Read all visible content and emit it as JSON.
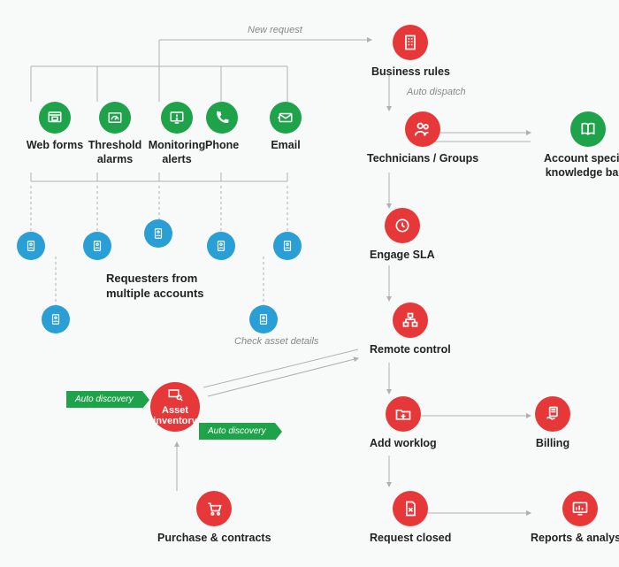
{
  "top_note": "New request",
  "inputs": {
    "web_forms": "Web forms",
    "threshold": "Threshold alarms",
    "monitoring": "Monitoring alerts",
    "phone": "Phone",
    "email": "Email"
  },
  "requesters_label": "Requesters from\nmultiple accounts",
  "flow": {
    "business_rules": "Business rules",
    "auto_dispatch_note": "Auto dispatch",
    "technicians": "Technicians / Groups",
    "knowledge_base": "Account specific knowledge base",
    "engage_sla": "Engage SLA",
    "remote_control": "Remote control",
    "check_asset_note": "Check asset details",
    "asset_inventory": "Asset inventory",
    "auto_discovery": "Auto discovery",
    "add_worklog": "Add worklog",
    "billing": "Billing",
    "request_closed": "Request closed",
    "reports": "Reports & analysis",
    "purchase": "Purchase & contracts"
  },
  "icons": {
    "web_forms": "browser-file-icon",
    "threshold": "gauge-icon",
    "monitoring": "alert-monitor-icon",
    "phone": "phone-icon",
    "email": "envelope-icon",
    "requester": "person-doc-icon",
    "business_rules": "building-icon",
    "technicians": "group-icon",
    "knowledge": "book-icon",
    "sla": "clock-icon",
    "remote": "network-icon",
    "asset": "monitor-search-icon",
    "worklog": "folder-plus-icon",
    "billing": "invoice-hand-icon",
    "closed": "doc-x-icon",
    "reports": "chart-screen-icon",
    "purchase": "cart-icon"
  },
  "colors": {
    "green": "#1fa34a",
    "red": "#e63838",
    "blue": "#2a9fd6",
    "line": "#b8b8b8",
    "dotted": "#bfbfbf"
  }
}
